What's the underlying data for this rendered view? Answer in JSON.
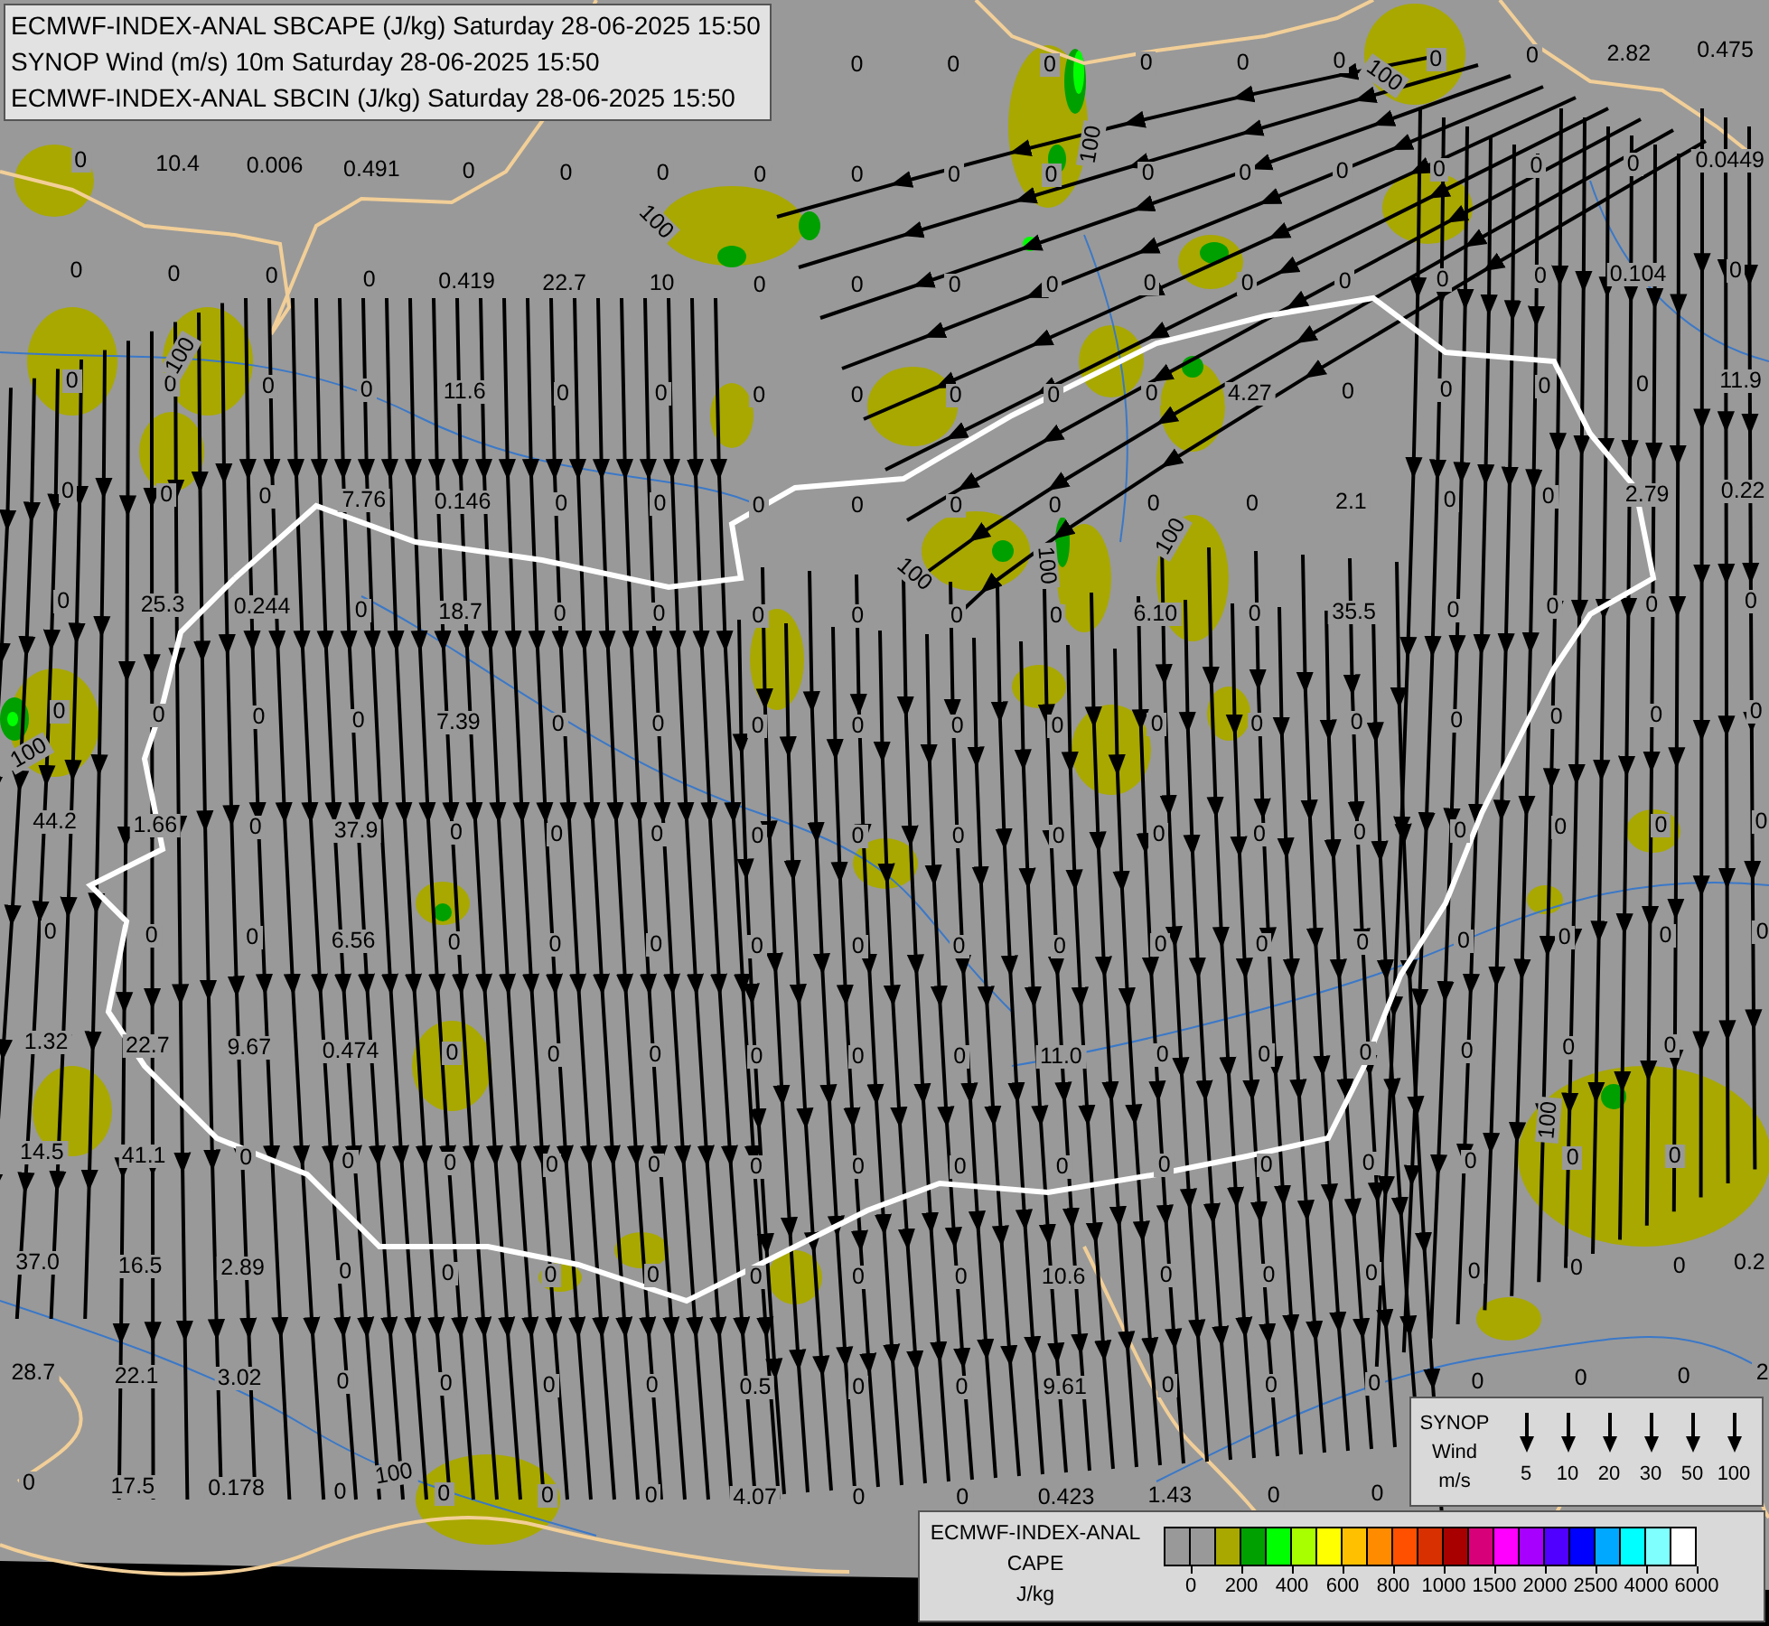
{
  "title_box": {
    "lines": [
      "ECMWF-INDEX-ANAL SBCAPE (J/kg) Saturday 28-06-2025 15:50",
      "SYNOP Wind (m/s) 10m Saturday 28-06-2025 15:50",
      "ECMWF-INDEX-ANAL SBCIN (J/kg) Saturday 28-06-2025 15:50"
    ]
  },
  "map": {
    "grid_values": [
      {
        "right_aligned": true,
        "values": [
          "0",
          "0",
          "0",
          "0",
          "0",
          "0",
          "0",
          "0",
          "2.82",
          "0.475"
        ]
      },
      [
        "0",
        "10.4",
        "0.006",
        "0.491",
        "0",
        "0",
        "0",
        "0",
        "0",
        "0",
        "0",
        "0",
        "0",
        "0",
        "0",
        "0",
        "0",
        "0.0449"
      ],
      [
        "0",
        "0",
        "0",
        "0",
        "0.419",
        "22.7",
        "10",
        "0",
        "0",
        "0",
        "0",
        "0",
        "0",
        "0",
        "0",
        "0",
        "0.104",
        "0"
      ],
      [
        "0",
        "0",
        "0",
        "0",
        "11.6",
        "0",
        "0",
        "0",
        "0",
        "0",
        "0",
        "0",
        "4.27",
        "0",
        "0",
        "0",
        "0",
        "11.9"
      ],
      [
        "0",
        "0",
        "0",
        "7.76",
        "0.146",
        "0",
        "0",
        "0",
        "0",
        "0",
        "0",
        "0",
        "0",
        "2.1",
        "0",
        "0",
        "2.79",
        "0.22"
      ],
      [
        "0",
        "25.3",
        "0.244",
        "0",
        "18.7",
        "0",
        "0",
        "0",
        "0",
        "0",
        "0",
        "6.10",
        "0",
        "35.5",
        "0",
        "0",
        "0",
        "0"
      ],
      [
        "0",
        "0",
        "0",
        "0",
        "7.39",
        "0",
        "0",
        "0",
        "0",
        "0",
        "0",
        "0",
        "0",
        "0",
        "0",
        "0",
        "0",
        "0"
      ],
      [
        "44.2",
        "1.66",
        "0",
        "37.9",
        "0",
        "0",
        "0",
        "0",
        "0",
        "0",
        "0",
        "0",
        "0",
        "0",
        "0",
        "0",
        "0",
        "0"
      ],
      [
        "0",
        "0",
        "0",
        "6.56",
        "0",
        "0",
        "0",
        "0",
        "0",
        "0",
        "0",
        "0",
        "0",
        "0",
        "0",
        "0",
        "0",
        "0"
      ],
      [
        "1.32",
        "22.7",
        "9.67",
        "0.474",
        "0",
        "0",
        "0",
        "0",
        "0",
        "0",
        "11.0",
        "0",
        "0",
        "0",
        "0",
        "0",
        "0"
      ],
      [
        "14.5",
        "41.1",
        "0",
        "0",
        "0",
        "0",
        "0",
        "0",
        "0",
        "0",
        "0",
        "0",
        "0",
        "0",
        "0",
        "0",
        "0"
      ],
      [
        "37.0",
        "16.5",
        "2.89",
        "0",
        "0",
        "0",
        "0",
        "0",
        "0",
        "0",
        "10.6",
        "0",
        "0",
        "0",
        "0",
        "0",
        "0",
        "0.2"
      ],
      [
        "28.7",
        "22.1",
        "3.02",
        "0",
        "0",
        "0",
        "0",
        "0.5",
        "0",
        "0",
        "9.61",
        "0",
        "0",
        "0",
        "0",
        "0",
        "0",
        "2"
      ],
      [
        "0",
        "17.5",
        "0.178",
        "0",
        "0",
        "0",
        "0",
        "4.07",
        "0",
        "0",
        "0.423",
        "1.43",
        "0",
        "0"
      ]
    ],
    "contour_labels": [
      "100",
      "100",
      "100",
      "100",
      "100",
      "100",
      "100",
      "100",
      "100",
      "100"
    ]
  },
  "wind_legend": {
    "lines": [
      "SYNOP",
      "Wind",
      "m/s"
    ],
    "speeds": [
      "5",
      "10",
      "20",
      "30",
      "50",
      "100"
    ]
  },
  "cape_legend": {
    "lines": [
      "ECMWF-INDEX-ANAL",
      "CAPE",
      "J/kg"
    ],
    "swatches": [
      {
        "color": "#999999"
      },
      {
        "color": "#999999"
      },
      {
        "color": "#a8a800"
      },
      {
        "color": "#00a000"
      },
      {
        "color": "#00ff00"
      },
      {
        "color": "#a8ff00"
      },
      {
        "color": "#ffff00"
      },
      {
        "color": "#ffc000"
      },
      {
        "color": "#ff8c00"
      },
      {
        "color": "#ff5000"
      },
      {
        "color": "#d83000"
      },
      {
        "color": "#a80000"
      },
      {
        "color": "#d80078"
      },
      {
        "color": "#ff00ff"
      },
      {
        "color": "#a800ff"
      },
      {
        "color": "#5000ff"
      },
      {
        "color": "#0000ff"
      },
      {
        "color": "#00a8ff"
      },
      {
        "color": "#00ffff"
      },
      {
        "color": "#80ffff"
      },
      {
        "color": "#ffffff"
      }
    ],
    "ticks": [
      "0",
      "200",
      "400",
      "600",
      "800",
      "1000",
      "1500",
      "2000",
      "2500",
      "4000",
      "6000"
    ]
  }
}
